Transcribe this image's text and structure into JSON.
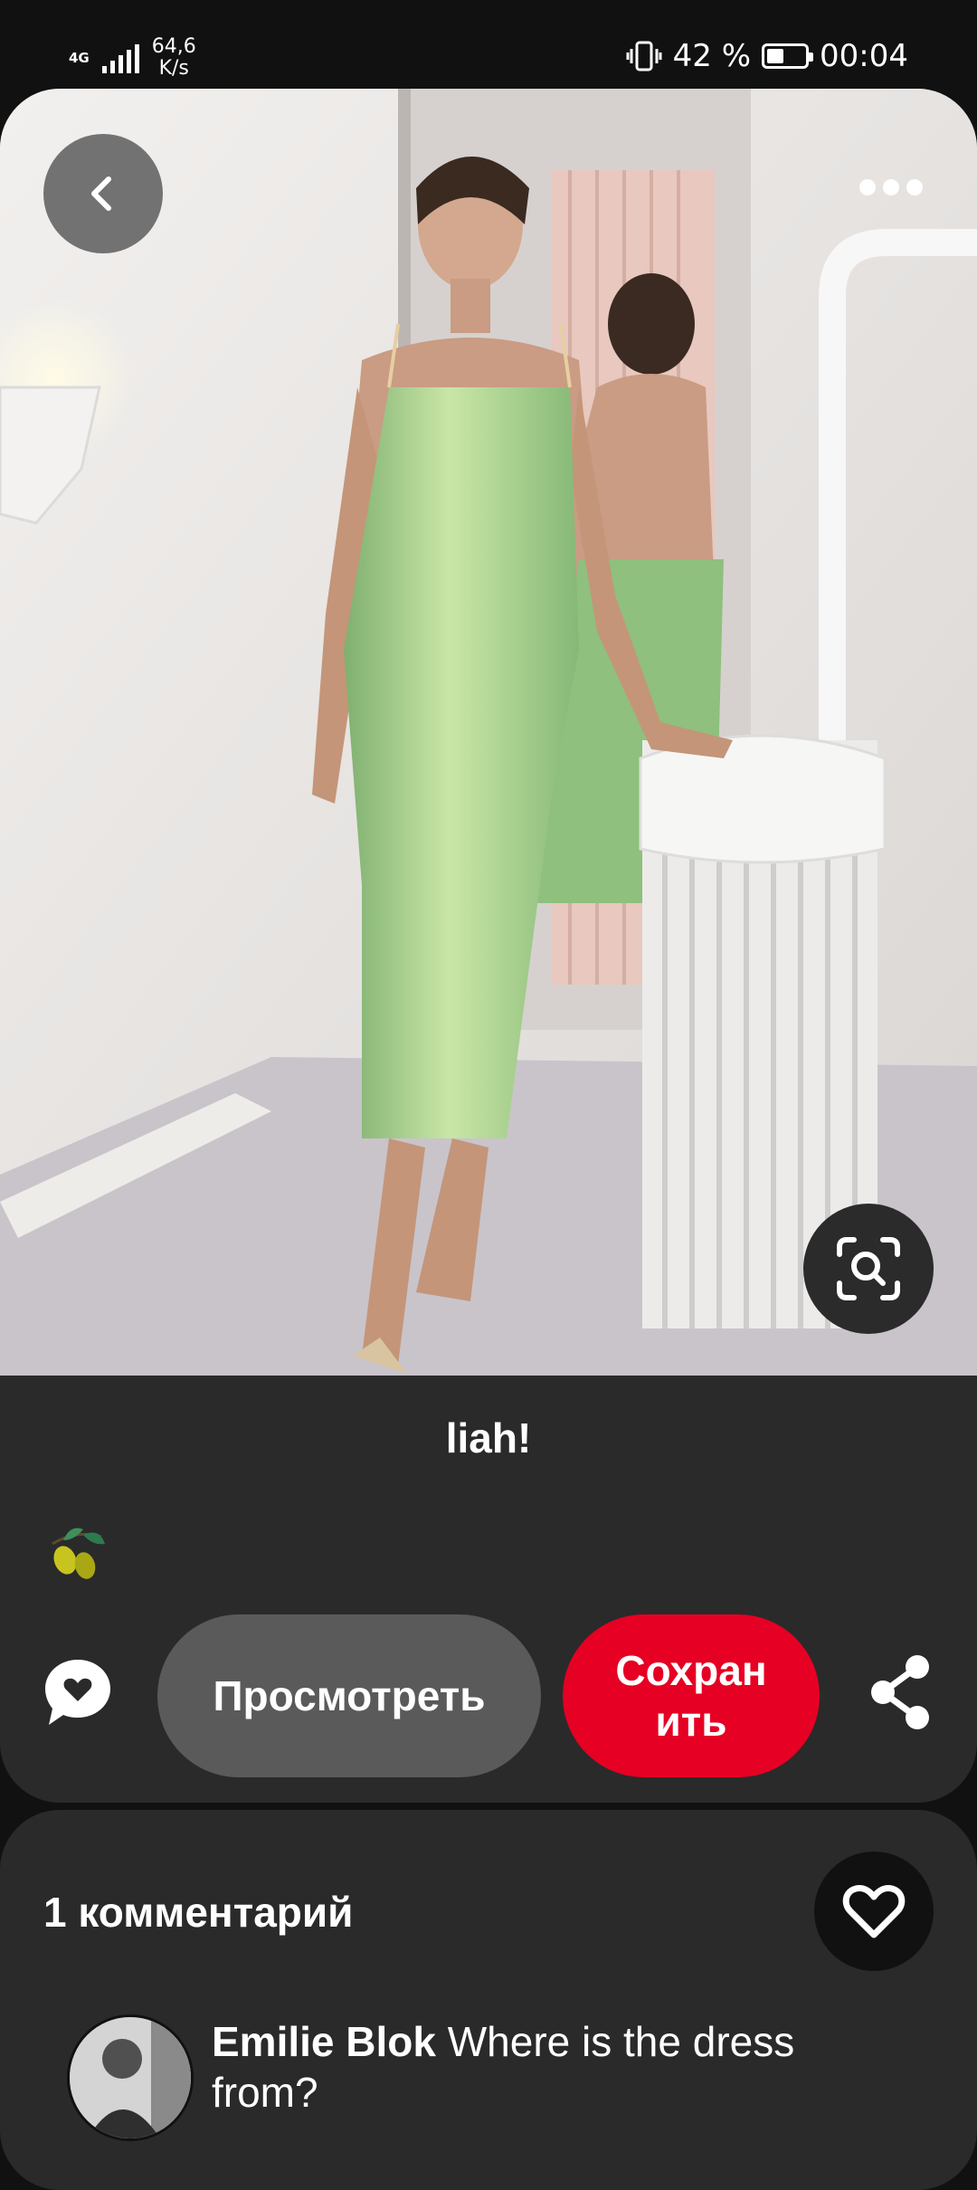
{
  "status_bar": {
    "network": "4G",
    "speed_value": "64,6",
    "speed_unit": "K/s",
    "battery": "42 %",
    "time": "00:04"
  },
  "pin": {
    "title": "liah!",
    "view_label": "Просмотреть",
    "save_label_line1": "Сохран",
    "save_label_line2": "ить"
  },
  "comments": {
    "count_label": "1 комментарий",
    "items": [
      {
        "author": "Emilie Blok",
        "text": "Where is the dress from?"
      }
    ]
  },
  "icons": {
    "back": "chevron-left-icon",
    "more": "more-horizontal-icon",
    "lens": "visual-search-icon",
    "board": "olive-icon",
    "message": "chat-heart-icon",
    "share": "share-icon",
    "like": "heart-outline-icon"
  },
  "colors": {
    "save_button": "#e60023",
    "card_background": "#2a2a2a",
    "page_background": "#111111",
    "view_button": "#5a5a5a"
  }
}
